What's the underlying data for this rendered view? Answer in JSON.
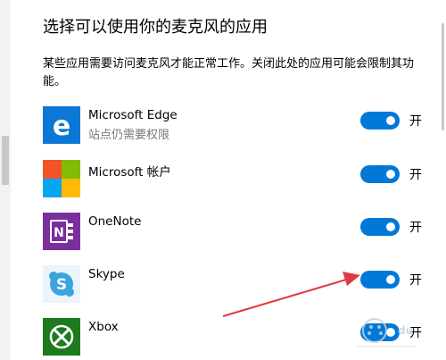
{
  "title": "选择可以使用你的麦克风的应用",
  "description": "某些应用需要访问麦克风才能正常工作。关闭此处的应用可能会限制其功能。",
  "apps": [
    {
      "name": "Microsoft Edge",
      "subtitle": "站点仍需要权限",
      "icon": "edge-icon",
      "toggle_label": "开",
      "enabled": true
    },
    {
      "name": "Microsoft 帐户",
      "subtitle": "",
      "icon": "microsoft-account-icon",
      "toggle_label": "开",
      "enabled": true
    },
    {
      "name": "OneNote",
      "subtitle": "",
      "icon": "onenote-icon",
      "toggle_label": "开",
      "enabled": true
    },
    {
      "name": "Skype",
      "subtitle": "",
      "icon": "skype-icon",
      "toggle_label": "开",
      "enabled": true
    },
    {
      "name": "Xbox",
      "subtitle": "",
      "icon": "xbox-icon",
      "toggle_label": "开",
      "enabled": true
    }
  ],
  "colors": {
    "toggle_on": "#0078d7",
    "edge": "#0a78d4",
    "onenote": "#7b2f9c",
    "skype": "#3aa4df",
    "xbox": "#1e7a1e",
    "annotation_arrow": "#e0393f"
  }
}
